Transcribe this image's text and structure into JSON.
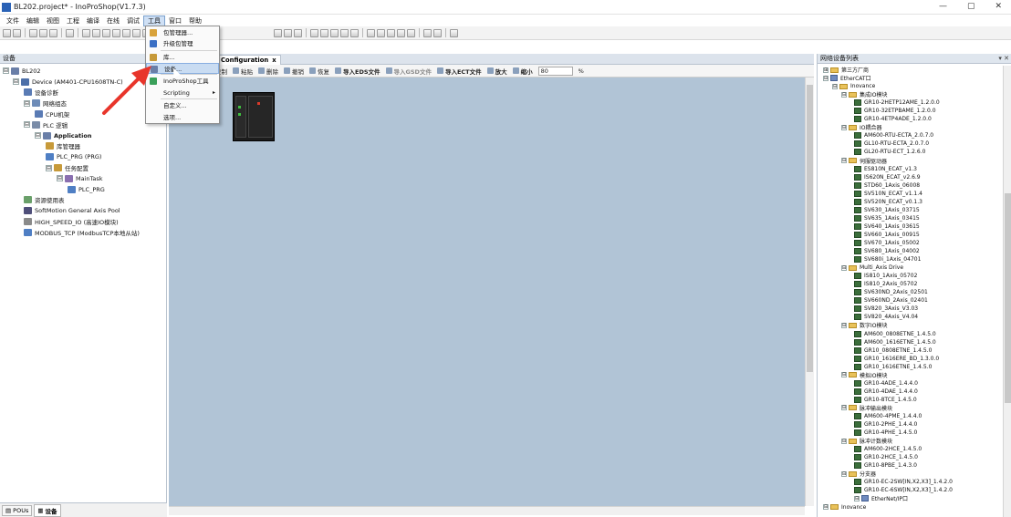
{
  "window": {
    "title": "BL202.project* - InoProShop(V1.7.3)",
    "controls": [
      "—",
      "▢",
      "✕"
    ]
  },
  "menu": [
    "文件",
    "编辑",
    "视图",
    "工程",
    "编译",
    "在线",
    "调试",
    "工具",
    "窗口",
    "帮助"
  ],
  "tools_menu": {
    "items": [
      {
        "label": "包管理器..."
      },
      {
        "label": "升级包管理"
      },
      {
        "label": "库..."
      },
      {
        "label": "设备..."
      },
      {
        "label": "InoProShop工具"
      },
      {
        "label": "Scripting",
        "submenu": "▸"
      },
      {
        "label": "自定义..."
      },
      {
        "label": "选项..."
      }
    ]
  },
  "left_panel": {
    "title": "设备",
    "pin": "▾ ✕",
    "tree": [
      {
        "label": "BL202",
        "exp": "⊟"
      },
      {
        "label": "Device (AM401-CPU1608TN-C)",
        "exp": "⊟"
      },
      {
        "label": "设备诊断",
        "exp": ""
      },
      {
        "label": "网络组态",
        "exp": "⊟"
      },
      {
        "label": "CPU机架",
        "exp": ""
      },
      {
        "label": "PLC 逻辑",
        "exp": "⊟"
      },
      {
        "label": "Application",
        "exp": "⊟"
      },
      {
        "label": "库管理器",
        "exp": ""
      },
      {
        "label": "PLC_PRG (PRG)",
        "exp": ""
      },
      {
        "label": "任务配置",
        "exp": "⊟"
      },
      {
        "label": "MainTask",
        "exp": "⊟"
      },
      {
        "label": "PLC_PRG",
        "exp": ""
      },
      {
        "label": "资源使用表",
        "exp": ""
      },
      {
        "label": "SoftMotion General Axis Pool",
        "exp": ""
      },
      {
        "label": "HIGH_SPEED_IO (高速IO模块)",
        "exp": ""
      },
      {
        "label": "MODBUS_TCP (ModbusTCP本地从站)",
        "exp": ""
      }
    ],
    "bottom_tabs": [
      "POUs",
      "设备"
    ]
  },
  "editor": {
    "tab_label": "Configuration",
    "tab_close": "x",
    "toolbar": [
      {
        "label": "复制",
        "disabled": false
      },
      {
        "label": "粘贴",
        "disabled": false
      },
      {
        "label": "删除",
        "disabled": false
      },
      {
        "label": "撤销",
        "disabled": false
      },
      {
        "label": "恢复",
        "disabled": false
      },
      {
        "label": "导入EDS文件",
        "disabled": false
      },
      {
        "label": "导入GSD文件",
        "disabled": true
      },
      {
        "label": "导入ECT文件",
        "disabled": false
      },
      {
        "label": "放大",
        "disabled": false
      },
      {
        "label": "缩小",
        "disabled": false
      }
    ],
    "zoom_value": "80",
    "zoom_unit": "%",
    "canvas_color": "#b1c4d6"
  },
  "right_panel": {
    "title": "网络设备列表",
    "pin": "▾ ✕",
    "tree": [
      {
        "label": "第三方厂商",
        "kind": "folder",
        "exp": "⊞"
      },
      {
        "label": "EtherCAT口",
        "kind": "net",
        "exp": "⊟"
      },
      {
        "label": "Inovance",
        "kind": "folder",
        "exp": "⊟"
      },
      {
        "label": "集成IO模块",
        "kind": "folder",
        "exp": "⊟"
      },
      {
        "label": "GR10-2HETP12AME_1.2.0.0",
        "kind": "dev",
        "exp": ""
      },
      {
        "label": "GR10-32ETPBAME_1.2.0.0",
        "kind": "dev",
        "exp": ""
      },
      {
        "label": "GR10-4ETP4ADE_1.2.0.0",
        "kind": "dev",
        "exp": ""
      },
      {
        "label": "IO耦合器",
        "kind": "folder",
        "exp": "⊟"
      },
      {
        "label": "AM600-RTU-ECTA_2.0.7.0",
        "kind": "dev",
        "exp": ""
      },
      {
        "label": "GL10-RTU-ECTA_2.0.7.0",
        "kind": "dev",
        "exp": ""
      },
      {
        "label": "GL20-RTU-ECT_1.2.6.0",
        "kind": "dev",
        "exp": ""
      },
      {
        "label": "伺服驱动器",
        "kind": "folder",
        "exp": "⊟"
      },
      {
        "label": "ES810N_ECAT_v1.3",
        "kind": "dev",
        "exp": ""
      },
      {
        "label": "IS620N_ECAT_v2.6.9",
        "kind": "dev",
        "exp": ""
      },
      {
        "label": "STD60_1Axis_06008",
        "kind": "dev",
        "exp": ""
      },
      {
        "label": "SV510N_ECAT_v1.1.4",
        "kind": "dev",
        "exp": ""
      },
      {
        "label": "SV520N_ECAT_v0.1.3",
        "kind": "dev",
        "exp": ""
      },
      {
        "label": "SV630_1Axis_03715",
        "kind": "dev",
        "exp": ""
      },
      {
        "label": "SV635_1Axis_03415",
        "kind": "dev",
        "exp": ""
      },
      {
        "label": "SV640_1Axis_03615",
        "kind": "dev",
        "exp": ""
      },
      {
        "label": "SV660_1Axis_00915",
        "kind": "dev",
        "exp": ""
      },
      {
        "label": "SV670_1Axis_05002",
        "kind": "dev",
        "exp": ""
      },
      {
        "label": "SV680_1Axis_04002",
        "kind": "dev",
        "exp": ""
      },
      {
        "label": "SV680i_1Axis_04701",
        "kind": "dev",
        "exp": ""
      },
      {
        "label": "Multi_Axis Drive",
        "kind": "folder",
        "exp": "⊟"
      },
      {
        "label": "IS810_1Axis_05702",
        "kind": "dev",
        "exp": ""
      },
      {
        "label": "IS810_2Axis_05702",
        "kind": "dev",
        "exp": ""
      },
      {
        "label": "SV630ND_2Axis_02501",
        "kind": "dev",
        "exp": ""
      },
      {
        "label": "SV660ND_2Axis_02401",
        "kind": "dev",
        "exp": ""
      },
      {
        "label": "SV820_3Axis_V3.03",
        "kind": "dev",
        "exp": ""
      },
      {
        "label": "SV820_4Axis_V4.04",
        "kind": "dev",
        "exp": ""
      },
      {
        "label": "数字IO模块",
        "kind": "folder",
        "exp": "⊟"
      },
      {
        "label": "AM600_0808ETNE_1.4.5.0",
        "kind": "dev",
        "exp": ""
      },
      {
        "label": "AM600_1616ETNE_1.4.5.0",
        "kind": "dev",
        "exp": ""
      },
      {
        "label": "GR10_0808ETNE_1.4.5.0",
        "kind": "dev",
        "exp": ""
      },
      {
        "label": "GR10_1616ERE_BD_1.3.0.0",
        "kind": "dev",
        "exp": ""
      },
      {
        "label": "GR10_1616ETNE_1.4.5.0",
        "kind": "dev",
        "exp": ""
      },
      {
        "label": "模拟IO模块",
        "kind": "folder",
        "exp": "⊟"
      },
      {
        "label": "GR10-4ADE_1.4.4.0",
        "kind": "dev",
        "exp": ""
      },
      {
        "label": "GR10-4DAE_1.4.4.0",
        "kind": "dev",
        "exp": ""
      },
      {
        "label": "GR10-8TCE_1.4.5.0",
        "kind": "dev",
        "exp": ""
      },
      {
        "label": "脉冲输出模块",
        "kind": "folder",
        "exp": "⊟"
      },
      {
        "label": "AM600-4PME_1.4.4.0",
        "kind": "dev",
        "exp": ""
      },
      {
        "label": "GR10-2PHE_1.4.4.0",
        "kind": "dev",
        "exp": ""
      },
      {
        "label": "GR10-4PHE_1.4.5.0",
        "kind": "dev",
        "exp": ""
      },
      {
        "label": "脉冲计数模块",
        "kind": "folder",
        "exp": "⊟"
      },
      {
        "label": "AM600-2HCE_1.4.5.0",
        "kind": "dev",
        "exp": ""
      },
      {
        "label": "GR10-2HCE_1.4.5.0",
        "kind": "dev",
        "exp": ""
      },
      {
        "label": "GR10-8PBE_1.4.3.0",
        "kind": "dev",
        "exp": ""
      },
      {
        "label": "分支器",
        "kind": "folder",
        "exp": "⊟"
      },
      {
        "label": "GR10-EC-2SW[IN,X2,X3]_1.4.2.0",
        "kind": "dev",
        "exp": ""
      },
      {
        "label": "GR10-EC-6SW[IN,X2,X3]_1.4.2.0",
        "kind": "dev",
        "exp": ""
      },
      {
        "label": "EtherNet/IP口",
        "kind": "net",
        "exp": "⊟"
      },
      {
        "label": "Inovance",
        "kind": "folder",
        "exp": "⊟"
      }
    ]
  },
  "colors": {
    "canvas": "#b1c4d6",
    "menu_highlight": "#c9dcf2",
    "annotation_arrow": "#e8352b",
    "spotlight": "#fff35a"
  }
}
